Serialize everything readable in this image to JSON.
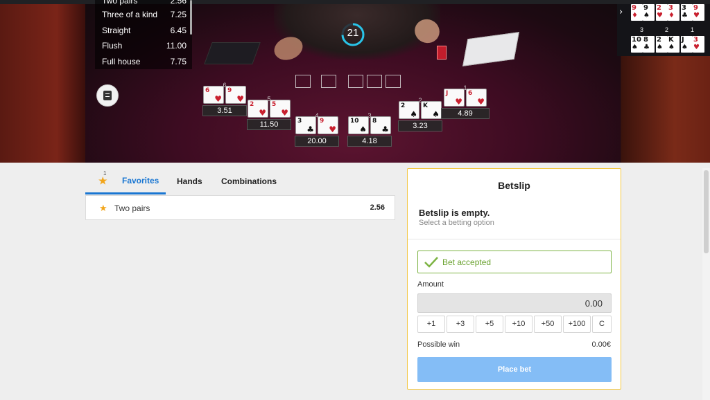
{
  "game": {
    "timer": "21",
    "payouts": [
      {
        "label": "Two pairs",
        "odds": "2.56"
      },
      {
        "label": "Three of a kind",
        "odds": "7.25"
      },
      {
        "label": "Straight",
        "odds": "6.45"
      },
      {
        "label": "Flush",
        "odds": "11.00"
      },
      {
        "label": "Full house",
        "odds": "7.75"
      }
    ],
    "hands": [
      {
        "num": "6",
        "odds": "3.51",
        "cards": [
          {
            "rank": "6",
            "suit": "♥",
            "color": "red"
          },
          {
            "rank": "9",
            "suit": "♥",
            "color": "red"
          }
        ]
      },
      {
        "num": "5",
        "odds": "11.50",
        "cards": [
          {
            "rank": "2",
            "suit": "♥",
            "color": "red"
          },
          {
            "rank": "5",
            "suit": "♥",
            "color": "red"
          }
        ]
      },
      {
        "num": "4",
        "odds": "20.00",
        "cards": [
          {
            "rank": "3",
            "suit": "♣",
            "color": "black"
          },
          {
            "rank": "9",
            "suit": "♥",
            "color": "red"
          }
        ]
      },
      {
        "num": "3",
        "odds": "4.18",
        "cards": [
          {
            "rank": "10",
            "suit": "♠",
            "color": "black"
          },
          {
            "rank": "8",
            "suit": "♣",
            "color": "black"
          }
        ]
      },
      {
        "num": "2",
        "odds": "3.23",
        "cards": [
          {
            "rank": "2",
            "suit": "♠",
            "color": "black"
          },
          {
            "rank": "K",
            "suit": "♠",
            "color": "black"
          }
        ]
      },
      {
        "num": "1",
        "odds": "4.89",
        "cards": [
          {
            "rank": "J",
            "suit": "♥",
            "color": "red"
          },
          {
            "rank": "6",
            "suit": "♥",
            "color": "red"
          }
        ]
      }
    ],
    "history_top": [
      {
        "rank": "9",
        "suit": "♦",
        "color": "red"
      },
      {
        "rank": "9",
        "suit": "♠",
        "color": "black"
      },
      {
        "rank": "2",
        "suit": "♥",
        "color": "red"
      },
      {
        "rank": "3",
        "suit": "♦",
        "color": "red"
      },
      {
        "rank": "3",
        "suit": "♣",
        "color": "black"
      },
      {
        "rank": "9",
        "suit": "♥",
        "color": "red"
      }
    ],
    "history_labels": [
      "3",
      "2",
      "1"
    ],
    "history_bottom": [
      {
        "rank": "10",
        "suit": "♠",
        "color": "black"
      },
      {
        "rank": "8",
        "suit": "♣",
        "color": "black"
      },
      {
        "rank": "2",
        "suit": "♠",
        "color": "black"
      },
      {
        "rank": "K",
        "suit": "♠",
        "color": "black"
      },
      {
        "rank": "J",
        "suit": "♠",
        "color": "black"
      },
      {
        "rank": "3",
        "suit": "♥",
        "color": "red"
      }
    ]
  },
  "tabs": {
    "favorites": "Favorites",
    "favorites_count": "1",
    "hands": "Hands",
    "combinations": "Combinations"
  },
  "favorites_list": [
    {
      "label": "Two pairs",
      "odds": "2.56"
    }
  ],
  "betslip": {
    "title": "Betslip",
    "empty_title": "Betslip is empty.",
    "empty_sub": "Select a betting option",
    "accepted": "Bet accepted",
    "amount_label": "Amount",
    "amount_value": "0.00",
    "chips": [
      "+1",
      "+3",
      "+5",
      "+10",
      "+50",
      "+100",
      "C"
    ],
    "possible_win_label": "Possible win",
    "possible_win_value": "0.00€",
    "place_bet": "Place bet"
  },
  "colors": {
    "accent": "#1976d2",
    "star": "#f2a51a",
    "success": "#7cb342",
    "place_bet": "#84bdf6",
    "betslip_border": "#f2c744"
  },
  "icons": [
    "star-icon",
    "notes-icon",
    "checkmark-icon",
    "chevron-right-icon",
    "timer-ring-icon"
  ]
}
